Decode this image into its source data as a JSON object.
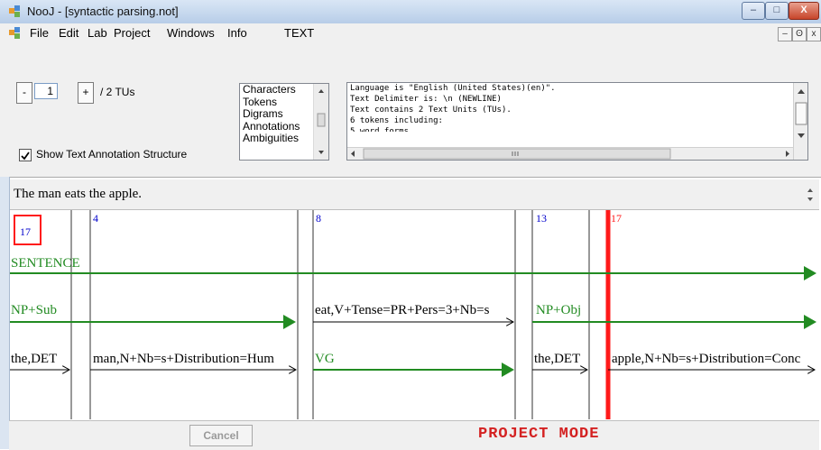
{
  "window": {
    "title": "NooJ - [syntactic parsing.not]",
    "minimize": "–",
    "maximize": "□",
    "close": "X"
  },
  "menubar": {
    "items": [
      "File",
      "Edit",
      "Lab",
      "Project",
      "Windows",
      "Info",
      "TEXT"
    ],
    "mdi_minimize": "–",
    "mdi_restore": "ʘ",
    "mdi_close": "x"
  },
  "navigation": {
    "decrement": "-",
    "tu_value": "1",
    "increment": "+",
    "tu_total": "/ 2 TUs"
  },
  "annotation_checkbox": {
    "label": "Show Text Annotation Structure",
    "checked": true
  },
  "view_list": {
    "items": [
      "Characters",
      "Tokens",
      "Digrams",
      "Annotations",
      "Ambiguities"
    ]
  },
  "info_box": {
    "lines": [
      "Language is \"English (United States)(en)\".",
      "Text Delimiter is: \\n (NEWLINE)",
      "Text contains 2 Text Units (TUs).",
      "6 tokens including:",
      "5 word forms"
    ]
  },
  "sentence": "The man eats the apple.",
  "tas": {
    "positions": [
      "17",
      "4",
      "8",
      "13",
      "17"
    ],
    "annotations": {
      "sentence": "SENTENCE",
      "np_subject": "NP+Sub",
      "eat": "eat,V+Tense=PR+Pers=3+Nb=s",
      "np_object": "NP+Obj",
      "the1": "the,DET",
      "man": "man,N+Nb=s+Distribution=Hum",
      "vg": "VG",
      "the2": "the,DET",
      "apple": "apple,N+Nb=s+Distribution=Conc"
    },
    "colors": {
      "syntactic": "#228b22",
      "lexical": "#000000",
      "cursor": "#ff1a1a",
      "position": "#0000cc"
    }
  },
  "status": {
    "cancel": "Cancel",
    "mode": "PROJECT MODE"
  }
}
